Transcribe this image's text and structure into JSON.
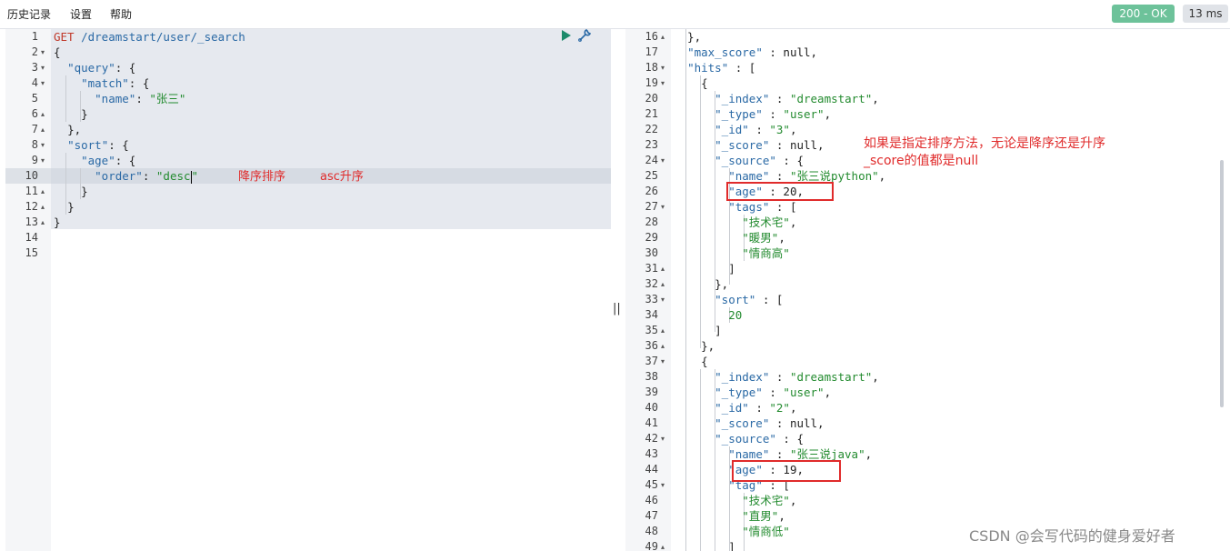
{
  "menu": [
    {
      "label": "历史记录"
    },
    {
      "label": "设置"
    },
    {
      "label": "帮助"
    }
  ],
  "status": {
    "code_text": "200 - OK",
    "time_text": "13 ms",
    "ok_color": "#6dc29a"
  },
  "request": {
    "lines": [
      {
        "n": "1",
        "fold": ""
      },
      {
        "n": "2",
        "fold": "▾"
      },
      {
        "n": "3",
        "fold": "▾"
      },
      {
        "n": "4",
        "fold": "▾"
      },
      {
        "n": "5",
        "fold": ""
      },
      {
        "n": "6",
        "fold": "▴"
      },
      {
        "n": "7",
        "fold": "▴"
      },
      {
        "n": "8",
        "fold": "▾"
      },
      {
        "n": "9",
        "fold": "▾"
      },
      {
        "n": "10",
        "fold": ""
      },
      {
        "n": "11",
        "fold": "▴"
      },
      {
        "n": "12",
        "fold": "▴"
      },
      {
        "n": "13",
        "fold": "▴"
      },
      {
        "n": "14",
        "fold": ""
      },
      {
        "n": "15",
        "fold": ""
      }
    ],
    "method": "GET",
    "path": " /dreamstart/user/_search",
    "brace_open": "{",
    "query_key": "\"query\"",
    "match_key": "\"match\"",
    "name_key": "\"name\"",
    "name_value": "\"张三\"",
    "sort_key": "\"sort\"",
    "age_key": "\"age\"",
    "order_key": "\"order\"",
    "order_value": "\"desc",
    "order_value_end": "\"",
    "colon_brace": ": {",
    "colon": ": ",
    "close": "}",
    "close_comma": "},",
    "brace_close": "}"
  },
  "annotations": {
    "desc_note": "降序排序",
    "asc_note": "asc升序",
    "score_note_1": "如果是指定排序方法，无论是降序还是升序",
    "score_note_2": "_score的值都是null"
  },
  "response": {
    "lines": [
      {
        "n": "16",
        "fold": "▴",
        "text": "  },"
      },
      {
        "n": "17",
        "fold": "",
        "text": "  \"max_score\" : null,"
      },
      {
        "n": "18",
        "fold": "▾",
        "text": "  \"hits\" : ["
      },
      {
        "n": "19",
        "fold": "▾",
        "text": "    {"
      },
      {
        "n": "20",
        "fold": "",
        "text": "      \"_index\" : \"dreamstart\","
      },
      {
        "n": "21",
        "fold": "",
        "text": "      \"_type\" : \"user\","
      },
      {
        "n": "22",
        "fold": "",
        "text": "      \"_id\" : \"3\","
      },
      {
        "n": "23",
        "fold": "",
        "text": "      \"_score\" : null,"
      },
      {
        "n": "24",
        "fold": "▾",
        "text": "      \"_source\" : {"
      },
      {
        "n": "25",
        "fold": "",
        "text": "        \"name\" : \"张三说python\","
      },
      {
        "n": "26",
        "fold": "",
        "text": "        \"age\" : 20,"
      },
      {
        "n": "27",
        "fold": "▾",
        "text": "        \"tags\" : ["
      },
      {
        "n": "28",
        "fold": "",
        "text": "          \"技术宅\","
      },
      {
        "n": "29",
        "fold": "",
        "text": "          \"暖男\","
      },
      {
        "n": "30",
        "fold": "",
        "text": "          \"情商高\""
      },
      {
        "n": "31",
        "fold": "▴",
        "text": "        ]"
      },
      {
        "n": "32",
        "fold": "▴",
        "text": "      },"
      },
      {
        "n": "33",
        "fold": "▾",
        "text": "      \"sort\" : ["
      },
      {
        "n": "34",
        "fold": "",
        "text": "        20"
      },
      {
        "n": "35",
        "fold": "▴",
        "text": "      ]"
      },
      {
        "n": "36",
        "fold": "▴",
        "text": "    },"
      },
      {
        "n": "37",
        "fold": "▾",
        "text": "    {"
      },
      {
        "n": "38",
        "fold": "",
        "text": "      \"_index\" : \"dreamstart\","
      },
      {
        "n": "39",
        "fold": "",
        "text": "      \"_type\" : \"user\","
      },
      {
        "n": "40",
        "fold": "",
        "text": "      \"_id\" : \"2\","
      },
      {
        "n": "41",
        "fold": "",
        "text": "      \"_score\" : null,"
      },
      {
        "n": "42",
        "fold": "▾",
        "text": "      \"_source\" : {"
      },
      {
        "n": "43",
        "fold": "",
        "text": "        \"name\" : \"张三说java\","
      },
      {
        "n": "44",
        "fold": "",
        "text": "        \"age\" : 19,"
      },
      {
        "n": "45",
        "fold": "▾",
        "text": "        \"tag\" : ["
      },
      {
        "n": "46",
        "fold": "",
        "text": "          \"技术宅\","
      },
      {
        "n": "47",
        "fold": "",
        "text": "          \"直男\","
      },
      {
        "n": "48",
        "fold": "",
        "text": "          \"情商低\""
      },
      {
        "n": "49",
        "fold": "▴",
        "text": "        ]"
      }
    ]
  },
  "divider": "||",
  "watermark": "CSDN @会写代码的健身爱好者",
  "icons": {
    "run": "play-icon",
    "settings": "wrench-icon"
  }
}
